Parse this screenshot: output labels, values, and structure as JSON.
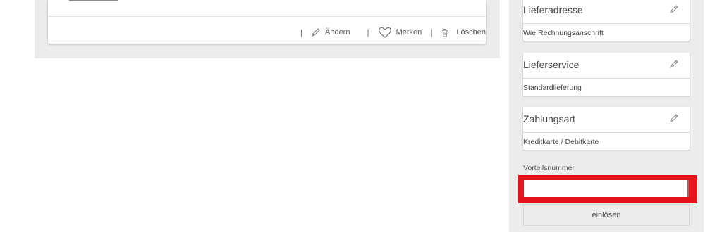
{
  "cart_item": {
    "actions": {
      "separator": "|",
      "edit_label": "Ändern",
      "wishlist_label": "Merken",
      "delete_label": "Löschen"
    }
  },
  "checkout": {
    "delivery_address": {
      "title": "Lieferadresse",
      "value": "Wie Rechnungsanschrift"
    },
    "delivery_service": {
      "title": "Lieferservice",
      "value": "Standardlieferung"
    },
    "payment": {
      "title": "Zahlungsart",
      "value": "Kreditkarte / Debitkarte"
    },
    "promo": {
      "label": "Vorteilsnummer",
      "input_value": "",
      "redeem_label": "einlösen"
    }
  },
  "icons": {
    "edit": "pencil-icon",
    "wishlist": "heart-icon",
    "delete": "trash-icon"
  },
  "colors": {
    "highlight": "#e5141b",
    "panel_background": "#ececec"
  }
}
